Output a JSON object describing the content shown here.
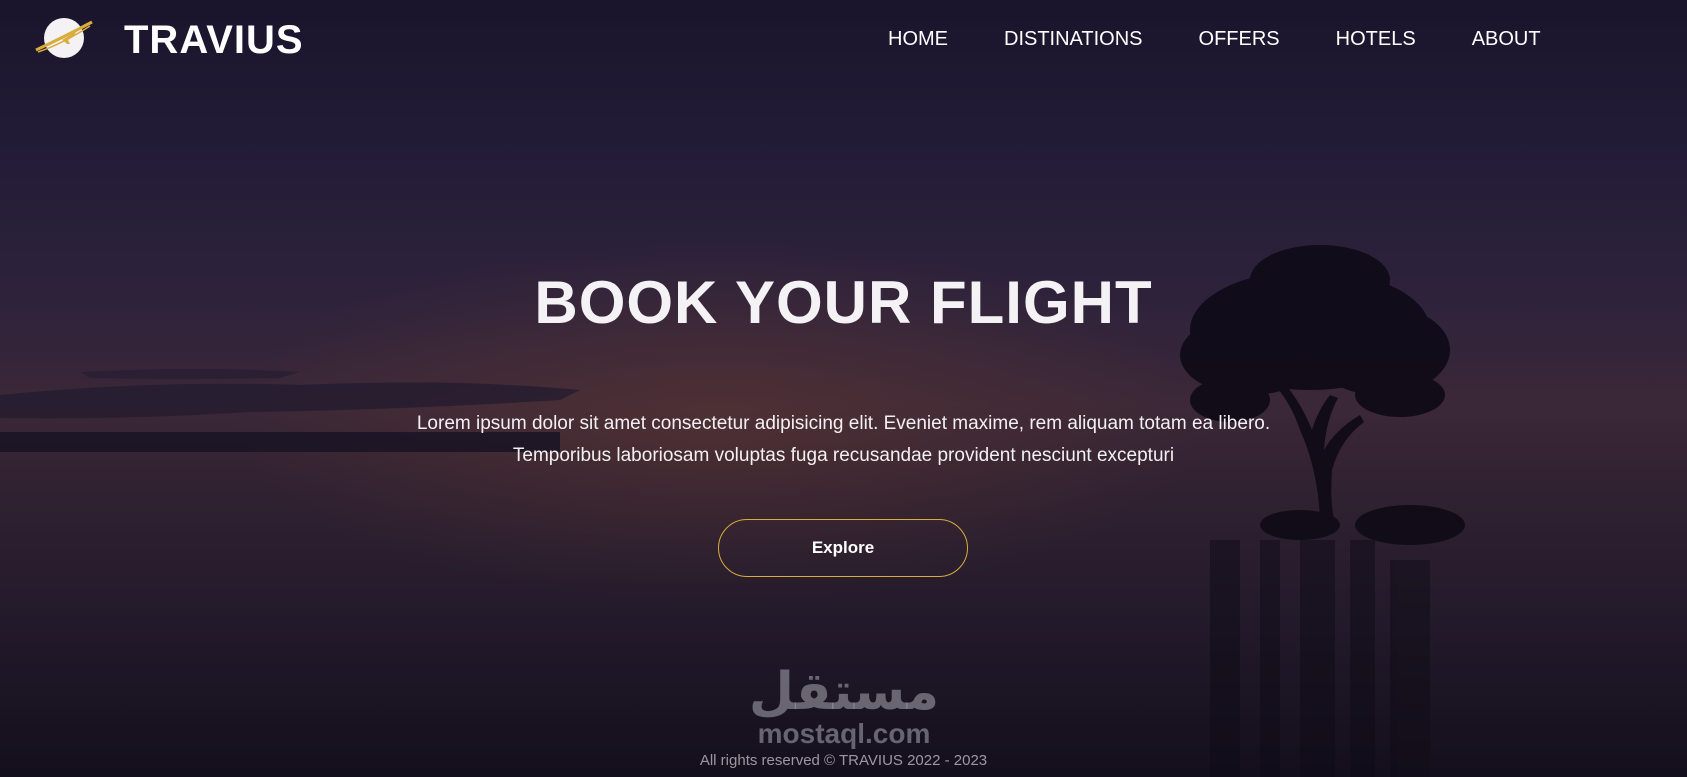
{
  "brand": {
    "name": "TRAVIUS",
    "logo_icon": "planet-plane-logo-icon"
  },
  "nav": {
    "items": [
      {
        "label": "HOME"
      },
      {
        "label": "DISTINATIONS"
      },
      {
        "label": "OFFERS"
      },
      {
        "label": "HOTELS"
      },
      {
        "label": "ABOUT"
      }
    ]
  },
  "hero": {
    "title": "BOOK YOUR FLIGHT",
    "line1": "Lorem ipsum dolor sit amet consectetur adipisicing elit. Eveniet maxime, rem aliquam totam ea libero.",
    "line2": "Temporibus laboriosam voluptas fuga recusandae provident nesciunt excepturi",
    "cta_label": "Explore"
  },
  "watermark": {
    "arabic": "مستقل",
    "latin": "mostaql.com"
  },
  "footer": {
    "text": "All rights reserved © TRAVIUS 2022 - 2023"
  },
  "colors": {
    "accent": "#d9ac3c",
    "text": "#ffffff"
  }
}
